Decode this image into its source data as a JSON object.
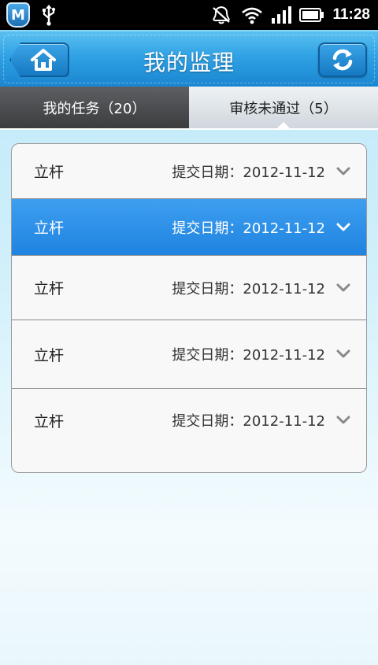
{
  "status_bar": {
    "app_badge": "M",
    "time": "11:28",
    "icons": [
      "app-shield-icon",
      "usb-icon",
      "mute-icon",
      "wifi-icon",
      "signal-icon",
      "battery-icon"
    ]
  },
  "header": {
    "title": "我的监理",
    "home_icon": "home-icon",
    "refresh_icon": "refresh-icon"
  },
  "tabs": [
    {
      "label": "我的任务（20）",
      "active": false
    },
    {
      "label": "审核未通过（5）",
      "active": true
    }
  ],
  "list": {
    "items": [
      {
        "name": "立杆",
        "date_text": "提交日期：2012-11-12",
        "selected": false
      },
      {
        "name": "立杆",
        "date_text": "提交日期：2012-11-12",
        "selected": true
      },
      {
        "name": "立杆",
        "date_text": "提交日期：2012-11-12",
        "selected": false
      },
      {
        "name": "立杆",
        "date_text": "提交日期：2012-11-12",
        "selected": false
      },
      {
        "name": "立杆",
        "date_text": "提交日期：2012-11-12",
        "selected": false
      }
    ]
  },
  "colors": {
    "header_blue": "#2fa1e4",
    "selected_row": "#2a8fe8",
    "active_tab_dark": "#3b3c3e"
  }
}
